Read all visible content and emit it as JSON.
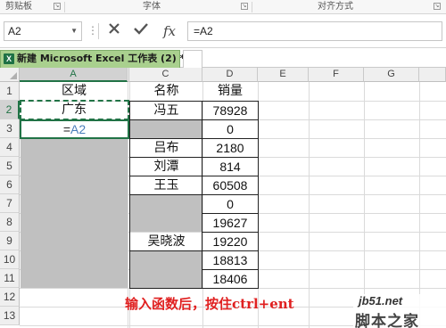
{
  "ribbon": {
    "groups": [
      {
        "label": "剪贴板"
      },
      {
        "label": "字体"
      },
      {
        "label": "对齐方式"
      }
    ]
  },
  "formula_bar": {
    "name_box": "A2",
    "cancel_icon": "close-icon",
    "enter_icon": "checkmark-icon",
    "fx_label": "fx",
    "formula": "=A2"
  },
  "workbook_tab": {
    "title": "新建 Microsoft Excel 工作表 (2) *",
    "icon": "excel-icon",
    "icon_letter": "X"
  },
  "columns": [
    "A",
    "B",
    "C",
    "D",
    "E",
    "F",
    "G"
  ],
  "active_column": "A",
  "rows": [
    "1",
    "2",
    "3",
    "4",
    "5",
    "6",
    "7",
    "8",
    "9",
    "10",
    "11",
    "12",
    "13"
  ],
  "cells": {
    "A1": "区域",
    "A2": "广东",
    "A3_prefix": "=",
    "A3_ref": "A2",
    "C1": "名称",
    "C2": "冯五",
    "C4": "吕布",
    "C5": "刘潭",
    "C6": "王玉",
    "C9": "吴晓波",
    "D1": "销量",
    "D2": "78928",
    "D3": "0",
    "D4": "2180",
    "D5": "814",
    "D6": "60508",
    "D7": "0",
    "D8": "19627",
    "D9": "19220",
    "D10": "18813",
    "D11": "18406"
  },
  "annotation": "输入函数后，按住ctrl+ent",
  "watermark": {
    "url": "jb51.net",
    "name": "脚本之家"
  },
  "colors": {
    "excel_green": "#217346",
    "tab_green": "#a9d08e",
    "selection_gray": "#c0c0c0",
    "annotation_red": "#e02020"
  }
}
